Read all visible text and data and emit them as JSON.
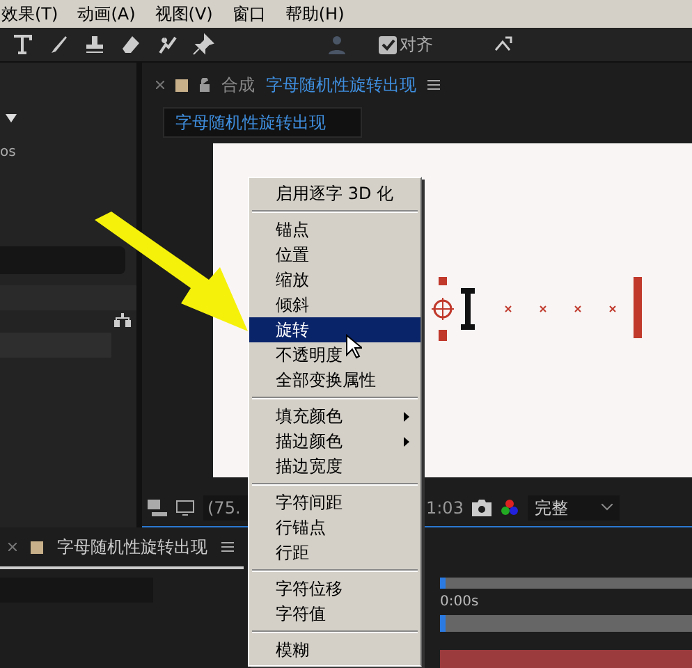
{
  "menu_bar": [
    {
      "label": "效果(T)"
    },
    {
      "label": "动画(A)"
    },
    {
      "label": "视图(V)"
    },
    {
      "label": "窗口"
    },
    {
      "label": "帮助(H)"
    }
  ],
  "toolbar": {
    "snap": {
      "label": "对齐",
      "checked": true
    }
  },
  "left_panel": {
    "text": "os"
  },
  "composition": {
    "tab_prefix": "合成",
    "tab_title": "字母随机性旋转出现",
    "breadcrumb": "字母随机性旋转出现",
    "zoom": "(75.",
    "time": "1:03",
    "resolution": "完整"
  },
  "context_menu": {
    "groups": [
      [
        {
          "label": "启用逐字 3D 化",
          "selected": false,
          "submenu": false
        }
      ],
      [
        {
          "label": "锚点",
          "selected": false,
          "submenu": false
        },
        {
          "label": "位置",
          "selected": false,
          "submenu": false
        },
        {
          "label": "缩放",
          "selected": false,
          "submenu": false
        },
        {
          "label": "倾斜",
          "selected": false,
          "submenu": false
        },
        {
          "label": "旋转",
          "selected": true,
          "submenu": false
        },
        {
          "label": "不透明度",
          "selected": false,
          "submenu": false
        },
        {
          "label": "全部变换属性",
          "selected": false,
          "submenu": false
        }
      ],
      [
        {
          "label": "填充颜色",
          "selected": false,
          "submenu": true
        },
        {
          "label": "描边颜色",
          "selected": false,
          "submenu": true
        },
        {
          "label": "描边宽度",
          "selected": false,
          "submenu": false
        }
      ],
      [
        {
          "label": "字符间距",
          "selected": false,
          "submenu": false
        },
        {
          "label": "行锚点",
          "selected": false,
          "submenu": false
        },
        {
          "label": "行距",
          "selected": false,
          "submenu": false
        }
      ],
      [
        {
          "label": "字符位移",
          "selected": false,
          "submenu": false
        },
        {
          "label": "字符值",
          "selected": false,
          "submenu": false
        }
      ],
      [
        {
          "label": "模糊",
          "selected": false,
          "submenu": false
        }
      ]
    ]
  },
  "timeline": {
    "tab_title": "字母随机性旋转出现",
    "ruler_start": "0:00s"
  }
}
